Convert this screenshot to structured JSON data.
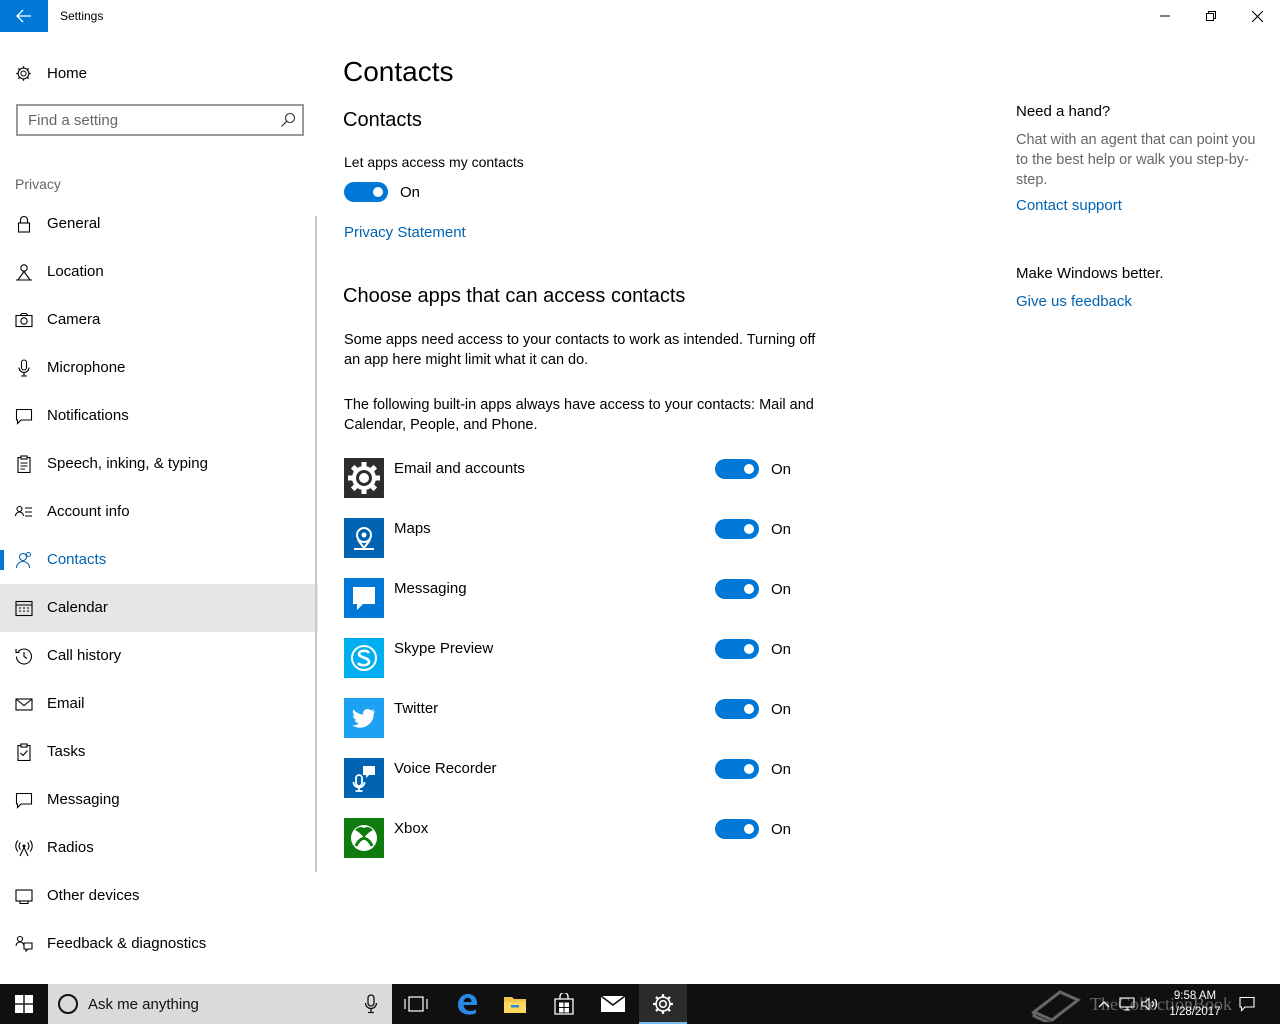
{
  "window": {
    "title": "Settings"
  },
  "sidebar": {
    "home_label": "Home",
    "search_placeholder": "Find a setting",
    "section_label": "Privacy",
    "items": [
      {
        "label": "General",
        "icon": "lock-icon"
      },
      {
        "label": "Location",
        "icon": "location-icon"
      },
      {
        "label": "Camera",
        "icon": "camera-icon"
      },
      {
        "label": "Microphone",
        "icon": "microphone-icon"
      },
      {
        "label": "Notifications",
        "icon": "notifications-icon"
      },
      {
        "label": "Speech, inking, & typing",
        "icon": "speech-icon"
      },
      {
        "label": "Account info",
        "icon": "account-info-icon"
      },
      {
        "label": "Contacts",
        "icon": "contacts-icon",
        "selected": true
      },
      {
        "label": "Calendar",
        "icon": "calendar-icon"
      },
      {
        "label": "Call history",
        "icon": "history-icon"
      },
      {
        "label": "Email",
        "icon": "mail-icon"
      },
      {
        "label": "Tasks",
        "icon": "tasks-icon"
      },
      {
        "label": "Messaging",
        "icon": "message-icon"
      },
      {
        "label": "Radios",
        "icon": "radio-icon"
      },
      {
        "label": "Other devices",
        "icon": "devices-icon"
      },
      {
        "label": "Feedback & diagnostics",
        "icon": "feedback-icon"
      }
    ]
  },
  "main": {
    "page_title": "Contacts",
    "section_title": "Contacts",
    "toggle_caption": "Let apps access my contacts",
    "toggle_state": "On",
    "privacy_link": "Privacy Statement",
    "choose_title": "Choose apps that can access contacts",
    "description_1": "Some apps need access to your contacts to work as intended. Turning off an app here might limit what it can do.",
    "description_2": "The following built-in apps always have access to your contacts: Mail and Calendar, People, and Phone.",
    "apps": [
      {
        "name": "Email and accounts",
        "state": "On",
        "icon": "gear-icon",
        "color": "#2d2d2d"
      },
      {
        "name": "Maps",
        "state": "On",
        "icon": "maps-icon",
        "color": "#0063b1"
      },
      {
        "name": "Messaging",
        "state": "On",
        "icon": "speech-bubble-icon",
        "color": "#0078d7"
      },
      {
        "name": "Skype Preview",
        "state": "On",
        "icon": "skype-icon",
        "color": "#00aff0"
      },
      {
        "name": "Twitter",
        "state": "On",
        "icon": "twitter-bird-icon",
        "color": "#1da1f2"
      },
      {
        "name": "Voice Recorder",
        "state": "On",
        "icon": "voice-recorder-icon",
        "color": "#0063b1"
      },
      {
        "name": "Xbox",
        "state": "On",
        "icon": "xbox-icon",
        "color": "#107c10"
      }
    ]
  },
  "help": {
    "title": "Need a hand?",
    "text": "Chat with an agent that can point you to the best help or walk you step-by-step.",
    "link": "Contact support",
    "better_title": "Make Windows better.",
    "feedback_link": "Give us feedback"
  },
  "taskbar": {
    "search_placeholder": "Ask me anything",
    "time": "9:58 AM",
    "date": "1/28/2017",
    "watermark": "TheCollectionBook"
  },
  "colors": {
    "accent": "#0078d7",
    "link": "#0063b1",
    "taskbar": "#101010"
  }
}
